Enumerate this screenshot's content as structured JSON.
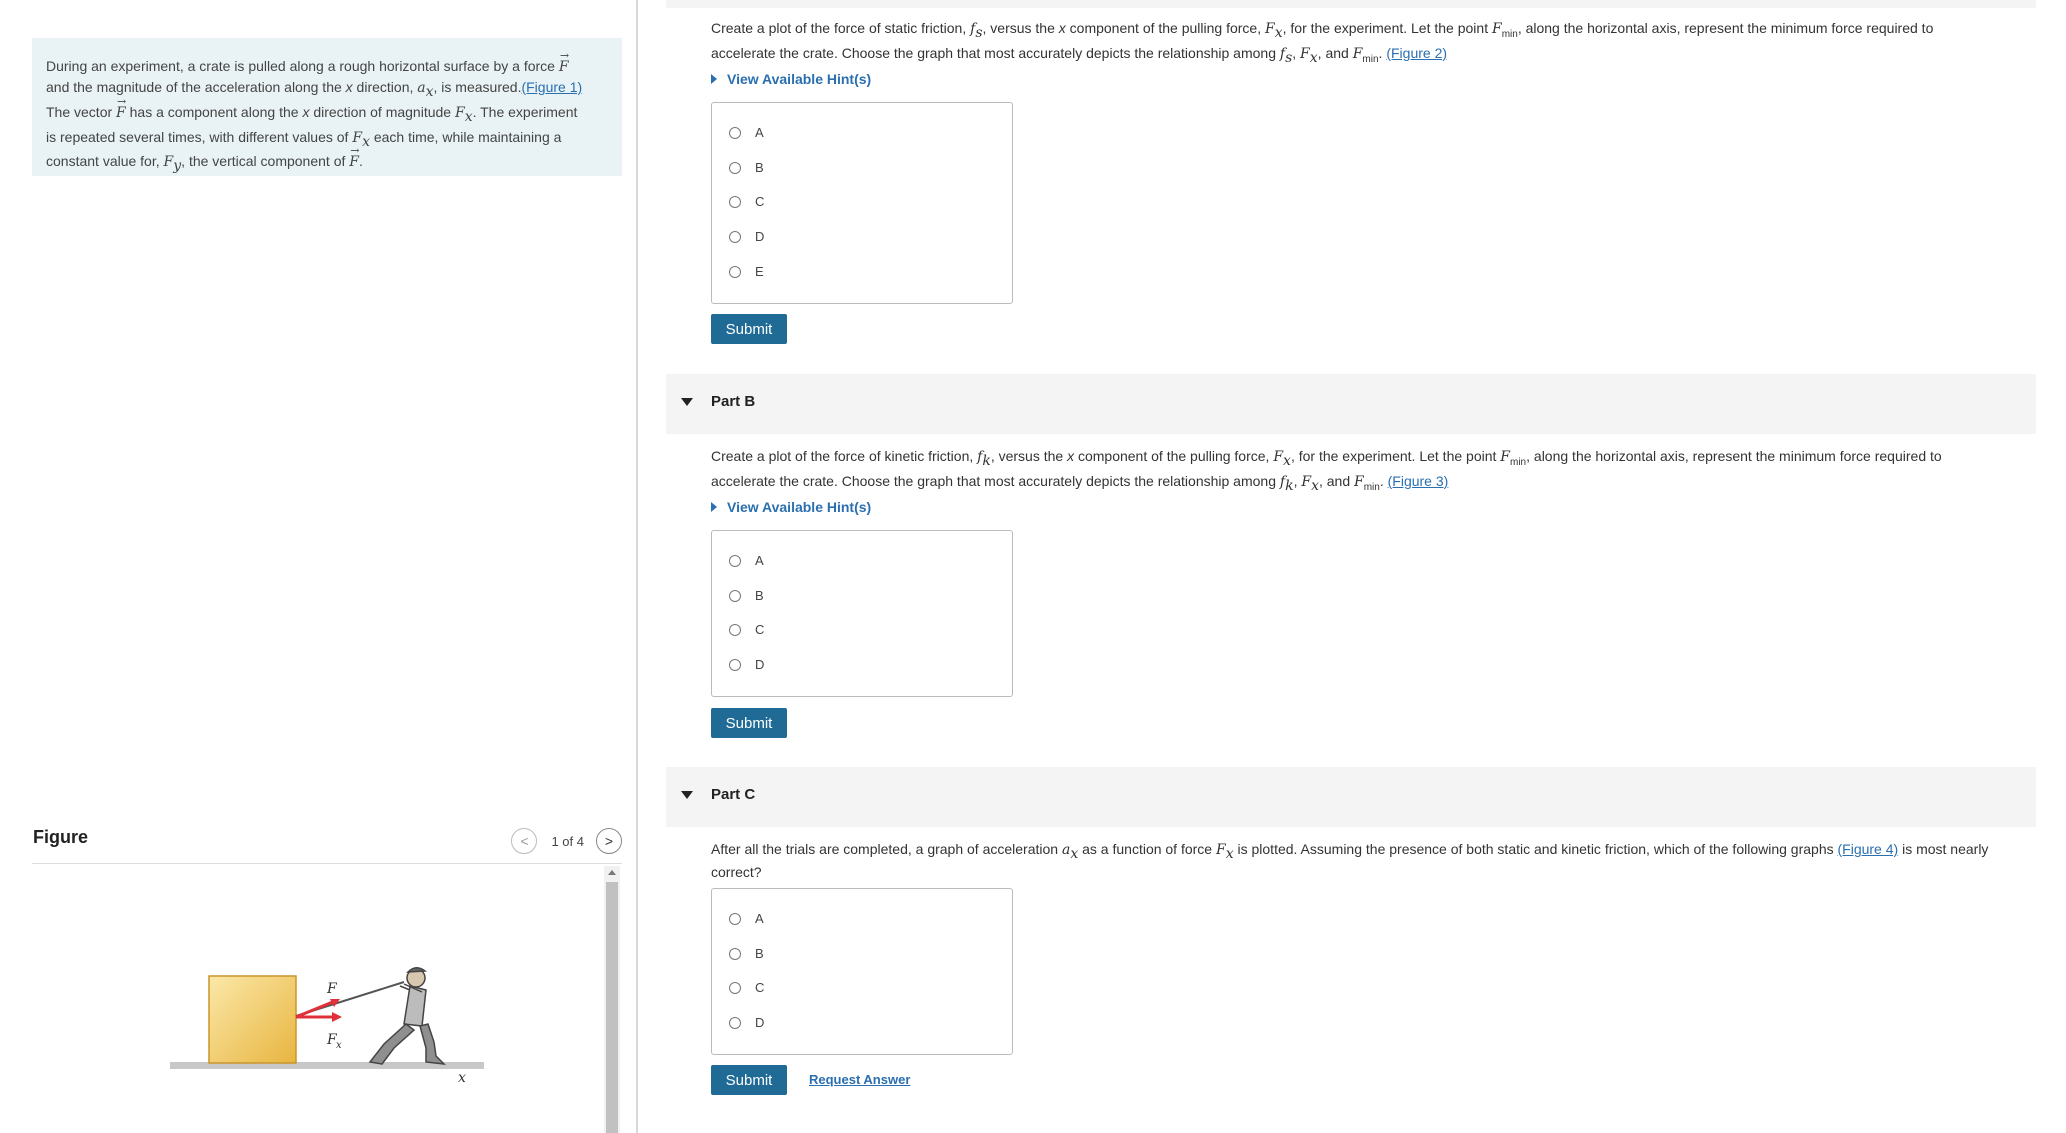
{
  "intro": {
    "l1_a": "During an experiment, a crate is pulled along a rough horizontal surface by a force ",
    "l1_F": "F",
    "l2_a": "and the magnitude of the acceleration along the ",
    "l2_x": "x",
    "l2_b": " direction, ",
    "l2_ax": "a",
    "l2_axsub": "x",
    "l2_c": ", is measured.",
    "l2_link": "(Figure 1)",
    "l3_a": "The vector ",
    "l3_F": "F",
    "l3_b": " has a component along the ",
    "l3_x": "x",
    "l3_c": " direction of magnitude ",
    "l3_Fx": "F",
    "l3_Fxsub": "x",
    "l3_d": ". The experiment",
    "l4_a": "is repeated several times, with different values of ",
    "l4_Fx": "F",
    "l4_Fxsub": "x",
    "l4_b": " each time, while maintaining a",
    "l5_a": "constant value for, ",
    "l5_Fy": "F",
    "l5_Fysub": "y",
    "l5_b": ", the vertical component of ",
    "l5_F": "F",
    "l5_c": "."
  },
  "figure": {
    "title": "Figure",
    "pager": "1 of 4",
    "prev_icon": "<",
    "next_icon": ">",
    "label_F": "F",
    "label_Fx": "F",
    "label_Fxsub": "x",
    "label_x": "x"
  },
  "partA": {
    "q1": "Create a plot of the force of static friction, ",
    "q_fs": "f",
    "q_fs_sub": "s",
    "q2": ", versus the ",
    "q_x": "x",
    "q3": " component of the pulling force, ",
    "q_Fx": "F",
    "q_Fx_sub": "x",
    "q4": ", for the experiment. Let the point ",
    "q_Fmin": "F",
    "q_Fmin_sub": "min",
    "q5": ", along the horizontal axis, represent the minimum force required to",
    "q6": "accelerate the crate. Choose the graph that most accurately depicts the relationship among ",
    "q_fs2": "f",
    "q_fs2_sub": "s",
    "q7": ", ",
    "q_Fx2": "F",
    "q_Fx2_sub": "x",
    "q8": ", and ",
    "q_Fmin2": "F",
    "q_Fmin2_sub": "min",
    "q9": ". ",
    "link": "(Figure 2)",
    "hint": "View Available Hint(s)",
    "options": [
      "A",
      "B",
      "C",
      "D",
      "E"
    ],
    "submit": "Submit"
  },
  "partB": {
    "title": "Part B",
    "q1": "Create a plot of the force of kinetic friction, ",
    "q_fk": "f",
    "q_fk_sub": "k",
    "q2": ", versus the ",
    "q_x": "x",
    "q3": " component of the pulling force, ",
    "q_Fx": "F",
    "q_Fx_sub": "x",
    "q4": ", for the experiment. Let the point ",
    "q_Fmin": "F",
    "q_Fmin_sub": "min",
    "q5": ", along the horizontal axis, represent the minimum force required to",
    "q6": "accelerate the crate. Choose the graph that most accurately depicts the relationship among ",
    "q_fk2": "f",
    "q_fk2_sub": "k",
    "q7": ", ",
    "q_Fx2": "F",
    "q_Fx2_sub": "x",
    "q8": ", and ",
    "q_Fmin2": "F",
    "q_Fmin2_sub": "min",
    "q9": ". ",
    "link": "(Figure 3)",
    "hint": "View Available Hint(s)",
    "options": [
      "A",
      "B",
      "C",
      "D"
    ],
    "submit": "Submit"
  },
  "partC": {
    "title": "Part C",
    "q1": "After all the trials are completed, a graph of acceleration ",
    "q_ax": "a",
    "q_ax_sub": "x",
    "q2": " as a function of force ",
    "q_Fx": "F",
    "q_Fx_sub": "x",
    "q3": " is plotted. Assuming the presence of both static and kinetic friction, which of the following graphs ",
    "link": "(Figure 4)",
    "q4": " is most nearly",
    "q5": "correct?",
    "options": [
      "A",
      "B",
      "C",
      "D"
    ],
    "submit": "Submit",
    "request_answer": "Request Answer"
  },
  "colors": {
    "intro_bg": "#e9f3f5",
    "link": "#2a6fb0",
    "submit_bg": "#1f6b95",
    "crate_fill": "#f2c760",
    "force_arrow": "#e0303a"
  }
}
